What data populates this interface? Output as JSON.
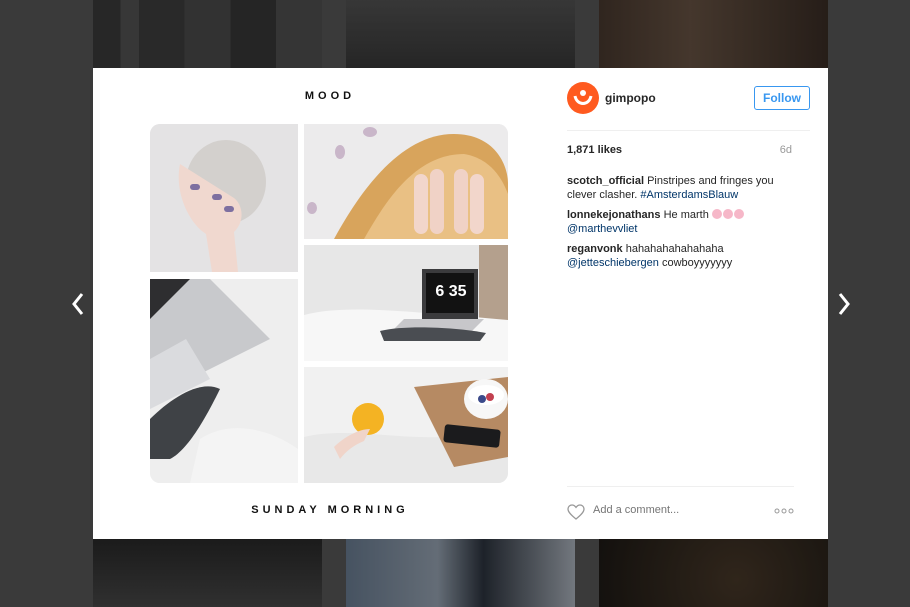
{
  "post": {
    "top_caption": "MOOD",
    "bottom_caption": "SUNDAY MORNING",
    "clock_text": "6 35"
  },
  "account": {
    "username": "gimpopo",
    "follow_label": "Follow",
    "avatar_color": "#ff5a1f"
  },
  "stats": {
    "likes": "1,871 likes",
    "age": "6d"
  },
  "comments": [
    {
      "user": "scotch_official",
      "text": "Pinstripes and fringes you clever clasher.",
      "link": "#AmsterdamsBlauw"
    },
    {
      "user": "lonnekejonathans",
      "text": "He marth",
      "link": "@marthevvliet"
    },
    {
      "user": "reganvonk",
      "text": "hahahahahahahaha",
      "link": "@jetteschiebergen",
      "tail": "cowboyyyyyyy"
    }
  ],
  "composer": {
    "placeholder": "Add a comment..."
  },
  "colors": {
    "accent": "#3897f0",
    "link": "#003569"
  },
  "icons": [
    "chevron-left-icon",
    "chevron-right-icon",
    "heart-icon",
    "more-options-icon"
  ]
}
